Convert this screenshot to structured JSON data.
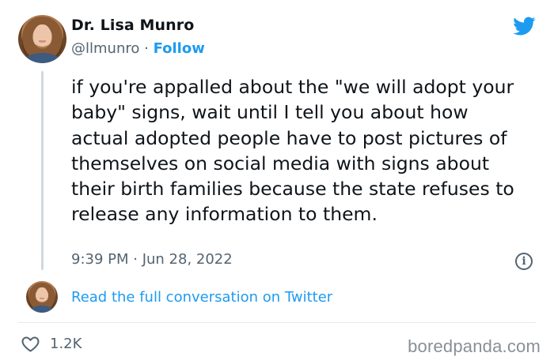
{
  "tweet": {
    "author_name": "Dr. Lisa Munro",
    "handle": "@llmunro",
    "separator": "·",
    "follow_label": "Follow",
    "text": "if you're appalled about the \"we will adopt your baby\" signs, wait until I tell you about how actual adopted people have to post pictures of themselves on social media with signs about their birth families because the state refuses to release any information to them.",
    "timestamp": "9:39 PM · Jun 28, 2022",
    "info_symbol": "i",
    "conversation_link": "Read the full conversation on Twitter",
    "like_count": "1.2K"
  },
  "watermark": "boredpanda.com",
  "icons": {
    "platform": "twitter-bird-icon",
    "like": "heart-icon",
    "info": "info-icon"
  },
  "colors": {
    "accent": "#1d9bf0",
    "text": "#0f1419",
    "secondary": "#536471",
    "divider": "#e6e9eb",
    "watermark": "#8a8f96"
  }
}
